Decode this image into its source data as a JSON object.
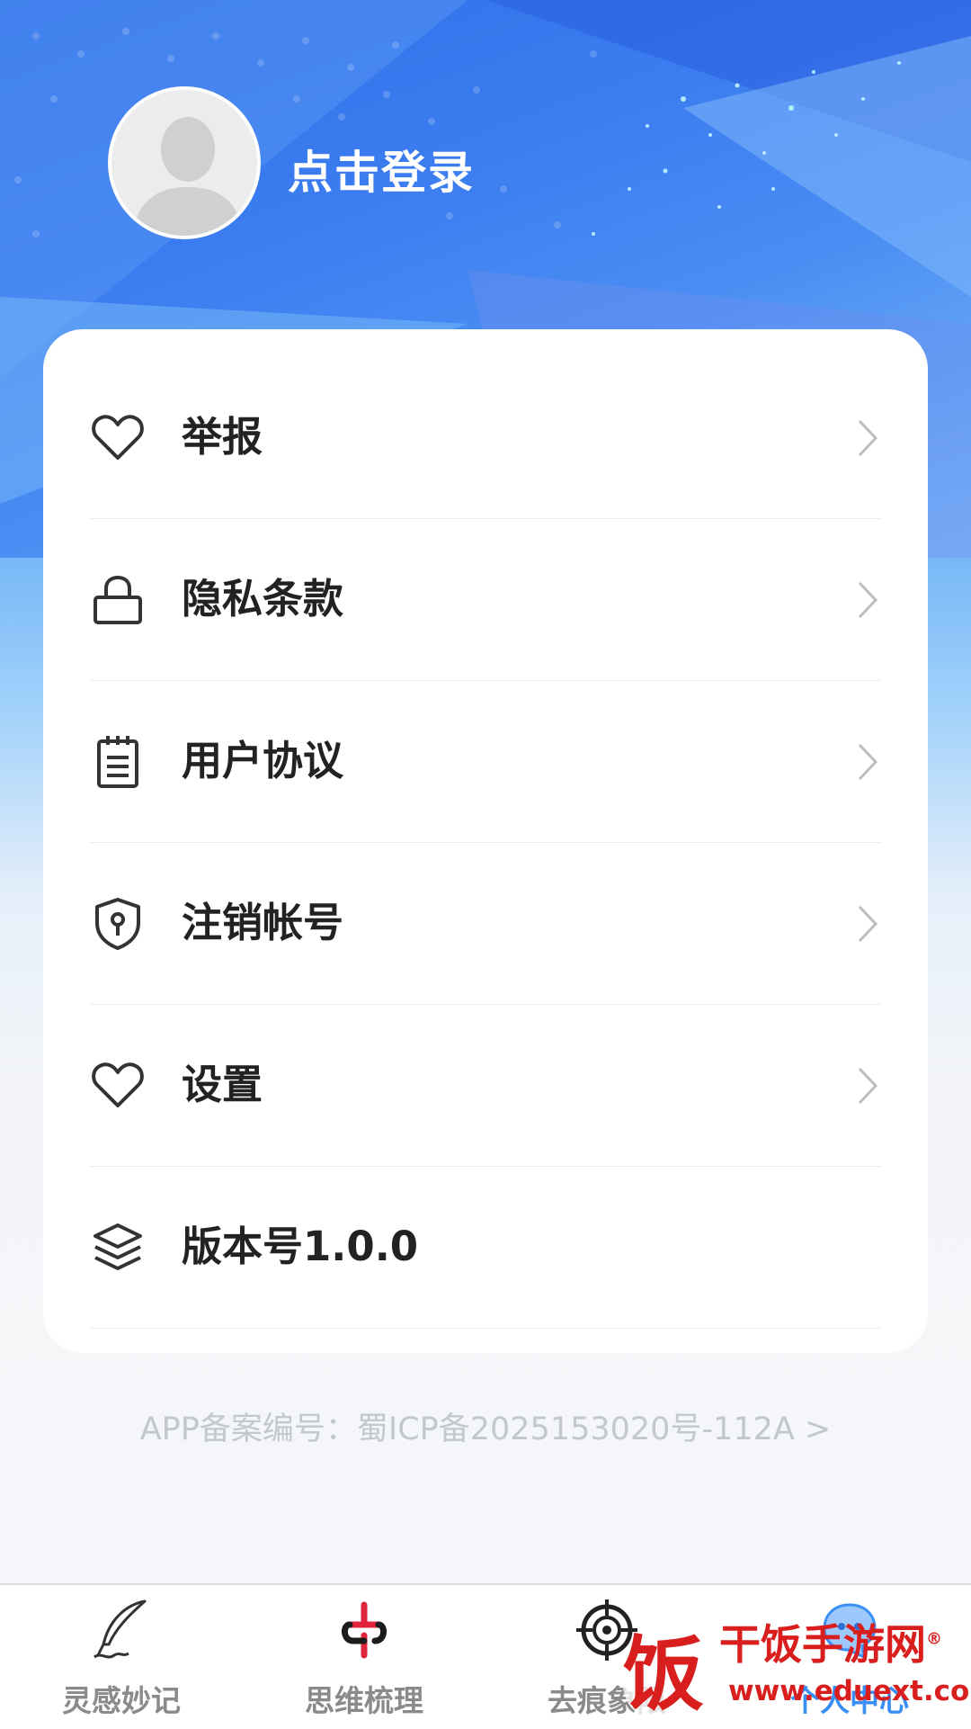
{
  "header": {
    "login_text": "点击登录",
    "avatar_icon": "default-avatar-icon"
  },
  "menu": {
    "items": [
      {
        "label": "举报",
        "icon": "heart-icon",
        "has_chevron": true
      },
      {
        "label": "隐私条款",
        "icon": "lock-icon",
        "has_chevron": true
      },
      {
        "label": "用户协议",
        "icon": "notepad-icon",
        "has_chevron": true
      },
      {
        "label": "注销帐号",
        "icon": "shield-keyhole-icon",
        "has_chevron": true
      },
      {
        "label": "设置",
        "icon": "heart-icon",
        "has_chevron": true
      },
      {
        "label": "版本号1.0.0",
        "icon": "layers-icon",
        "has_chevron": false
      }
    ]
  },
  "footer": {
    "icp_text": "APP备案编号：蜀ICP备2025153020号-112A >"
  },
  "tabbar": {
    "tabs": [
      {
        "label": "灵感妙记",
        "icon": "quill-icon",
        "active": false
      },
      {
        "label": "思维梳理",
        "icon": "knot-icon",
        "active": false
      },
      {
        "label": "去痕象限",
        "icon": "crosshair-icon",
        "active": false
      },
      {
        "label": "个人中心",
        "icon": "chat-face-icon",
        "active": true
      }
    ]
  },
  "watermark": {
    "glyph": "饭",
    "title": "干饭手游网",
    "registered": "®",
    "url": "www.eduext.com"
  },
  "colors": {
    "primary_blue": "#3b7cf0",
    "active_tab": "#3a8ff5",
    "text_dark": "#222222",
    "icp_gray": "#c3c8cf",
    "watermark_red": "#d91e1e"
  }
}
